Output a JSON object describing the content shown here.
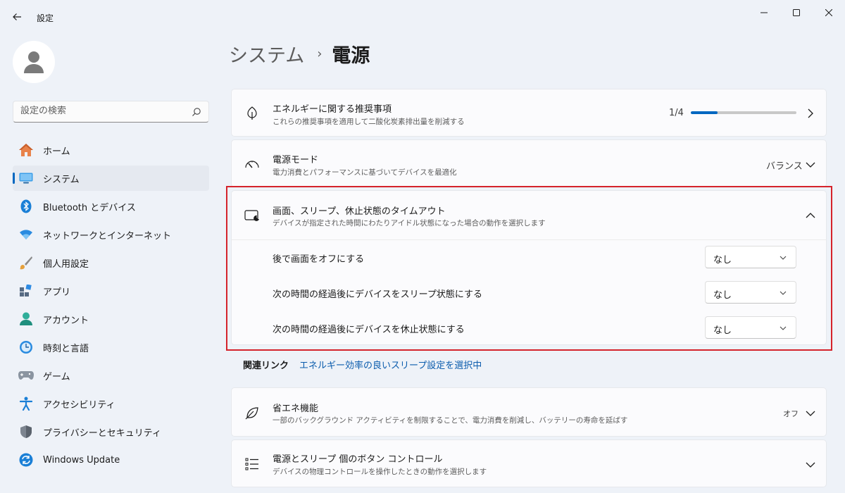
{
  "window": {
    "title": "設定",
    "controls": [
      "minimize",
      "maximize",
      "close"
    ]
  },
  "sidebar": {
    "search_placeholder": "設定の検索",
    "items": [
      {
        "label": "ホーム",
        "icon": "home-icon"
      },
      {
        "label": "システム",
        "icon": "system-icon",
        "selected": true
      },
      {
        "label": "Bluetooth とデバイス",
        "icon": "bluetooth-icon"
      },
      {
        "label": "ネットワークとインターネット",
        "icon": "network-icon"
      },
      {
        "label": "個人用設定",
        "icon": "personalization-icon"
      },
      {
        "label": "アプリ",
        "icon": "apps-icon"
      },
      {
        "label": "アカウント",
        "icon": "account-icon"
      },
      {
        "label": "時刻と言語",
        "icon": "time-language-icon"
      },
      {
        "label": "ゲーム",
        "icon": "gaming-icon"
      },
      {
        "label": "アクセシビリティ",
        "icon": "accessibility-icon"
      },
      {
        "label": "プライバシーとセキュリティ",
        "icon": "privacy-icon"
      },
      {
        "label": "Windows Update",
        "icon": "windows-update-icon"
      }
    ]
  },
  "breadcrumb": {
    "parent": "システム",
    "separator": "›",
    "current": "電源"
  },
  "cards": {
    "energy": {
      "title": "エネルギーに関する推奨事項",
      "subtitle": "これらの推奨事項を適用して二酸化炭素排出量を削減する",
      "progress_text": "1/4",
      "progress_fraction": 0.25
    },
    "power_mode": {
      "title": "電源モード",
      "subtitle": "電力消費とパフォーマンスに基づいてデバイスを最適化",
      "value": "バランス"
    },
    "screen_sleep": {
      "title": "画面、スリープ、休止状態のタイムアウト",
      "subtitle": "デバイスが指定された時間にわたりアイドル状態になった場合の動作を選択します",
      "settings": [
        {
          "label": "後で画面をオフにする",
          "value": "なし"
        },
        {
          "label": "次の時間の経過後にデバイスをスリープ状態にする",
          "value": "なし"
        },
        {
          "label": "次の時間の経過後にデバイスを休止状態にする",
          "value": "なし"
        }
      ]
    },
    "energy_saver": {
      "title": "省エネ機能",
      "subtitle": "一部のバックグラウンド アクティビティを制限することで、電力消費を削減し、バッテリーの寿命を延ばす",
      "value": "オフ"
    },
    "power_buttons": {
      "title": "電源とスリープ 個のボタン コントロール",
      "subtitle": "デバイスの物理コントロールを操作したときの動作を選択します"
    }
  },
  "related": {
    "label": "関連リンク",
    "link": "エネルギー効率の良いスリープ設定を選択中"
  },
  "colors": {
    "accent": "#0067c0",
    "highlight_border": "#d5232b",
    "background": "#eef2f8",
    "card": "#fbfbfd"
  }
}
